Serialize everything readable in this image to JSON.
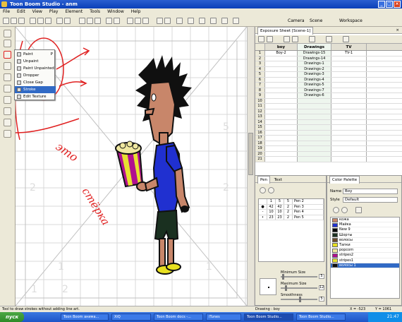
{
  "window": {
    "title": "Toon Boom Studio - anm"
  },
  "menu": [
    "File",
    "Edit",
    "View",
    "Play",
    "Element",
    "Tools",
    "Window",
    "Help"
  ],
  "toolbar": {
    "camera_label": "Camera",
    "scene_label": "Scene",
    "workspace_label": "Workspace"
  },
  "context_menu": {
    "items": [
      {
        "label": "Paint",
        "shortcut": "P",
        "selected": false
      },
      {
        "label": "Unpaint",
        "selected": false
      },
      {
        "label": "Paint Unpainted",
        "selected": false
      },
      {
        "label": "Dropper",
        "selected": false
      },
      {
        "label": "Close Gap",
        "selected": false
      },
      {
        "label": "Stroke",
        "selected": true
      },
      {
        "label": "Edit Texture",
        "selected": false
      }
    ]
  },
  "annotation": {
    "handwritten_text_1": "это",
    "handwritten_text_2": "стёрка",
    "color": "#e02020"
  },
  "exposure_sheet": {
    "tab_label": "Exposure Sheet [Scene-1]",
    "columns": [
      "boy",
      "Drawings",
      "TV"
    ],
    "rows": [
      {
        "frame": "1",
        "boy": "Boy-2",
        "drawings": "Drawings-15",
        "tv": "TV-1"
      },
      {
        "frame": "2",
        "boy": "",
        "drawings": "Drawings-14",
        "tv": ""
      },
      {
        "frame": "3",
        "boy": "",
        "drawings": "Drawings-1",
        "tv": ""
      },
      {
        "frame": "4",
        "boy": "",
        "drawings": "Drawings-2",
        "tv": ""
      },
      {
        "frame": "5",
        "boy": "",
        "drawings": "Drawings-3",
        "tv": ""
      },
      {
        "frame": "6",
        "boy": "",
        "drawings": "Drawings-4",
        "tv": ""
      },
      {
        "frame": "7",
        "boy": "",
        "drawings": "Drawings-5",
        "tv": ""
      },
      {
        "frame": "8",
        "boy": "",
        "drawings": "Drawings-7",
        "tv": ""
      },
      {
        "frame": "9",
        "boy": "",
        "drawings": "Drawings-6",
        "tv": ""
      },
      {
        "frame": "10",
        "boy": "",
        "drawings": "",
        "tv": ""
      },
      {
        "frame": "11",
        "boy": "",
        "drawings": "",
        "tv": ""
      },
      {
        "frame": "12",
        "boy": "",
        "drawings": "",
        "tv": ""
      },
      {
        "frame": "13",
        "boy": "",
        "drawings": "",
        "tv": ""
      },
      {
        "frame": "14",
        "boy": "",
        "drawings": "",
        "tv": ""
      },
      {
        "frame": "15",
        "boy": "",
        "drawings": "",
        "tv": ""
      },
      {
        "frame": "16",
        "boy": "",
        "drawings": "",
        "tv": ""
      },
      {
        "frame": "17",
        "boy": "",
        "drawings": "",
        "tv": ""
      },
      {
        "frame": "18",
        "boy": "",
        "drawings": "",
        "tv": ""
      },
      {
        "frame": "19",
        "boy": "",
        "drawings": "",
        "tv": ""
      },
      {
        "frame": "20",
        "boy": "",
        "drawings": "",
        "tv": ""
      },
      {
        "frame": "21",
        "boy": "",
        "drawings": "",
        "tv": ""
      }
    ]
  },
  "pen_panel": {
    "tabs": [
      "Pen",
      "Text"
    ],
    "rows": [
      {
        "a": "1",
        "b": "5",
        "c": "5",
        "name": "Pen 2"
      },
      {
        "a": "42",
        "b": "42",
        "c": "2",
        "name": "Pen 3"
      },
      {
        "a": "10",
        "b": "10",
        "c": "2",
        "name": "Pen 4"
      },
      {
        "a": "23",
        "b": "23",
        "c": "2",
        "name": "Pen 5"
      }
    ],
    "min_size_label": "Minimum Size",
    "min_size_value": "5",
    "max_size_label": "Maximum Size",
    "max_size_value": "12",
    "smoothness_label": "Smoothness",
    "smoothness_value": "5"
  },
  "color_palette": {
    "tab_label": "Color Palette",
    "name_label": "Name",
    "name_value": "Boy",
    "style_label": "Style",
    "style_value": "Default",
    "swatches": [
      {
        "name": "кожа",
        "color": "#c8866a"
      },
      {
        "name": "Майка",
        "color": "#2030d0"
      },
      {
        "name": "New 9",
        "color": "#000000"
      },
      {
        "name": "Шорты",
        "color": "#1a3020"
      },
      {
        "name": "волосы",
        "color": "#6a4a2a"
      },
      {
        "name": "Тапки",
        "color": "#e8e020"
      },
      {
        "name": "popcorn",
        "color": "#f0e8a0"
      },
      {
        "name": "stripes2",
        "color": "#b01090"
      },
      {
        "name": "stripes1",
        "color": "#e8e030"
      },
      {
        "name": "волосы 1",
        "color": "#101010"
      }
    ]
  },
  "status": {
    "tip": "Tool to draw strokes without adding line art.",
    "drawing": "Drawing : boy",
    "x": "X = -523",
    "y": "Y = 1061"
  },
  "taskbar": {
    "start_label": "пуск",
    "tasks": [
      "Toon Boom анима...",
      "XiQ",
      "Toon Boom docs -...",
      "iTunes",
      "Toon Boom Studio...",
      "Toon Boom Studio..."
    ],
    "clock": "21:47"
  }
}
